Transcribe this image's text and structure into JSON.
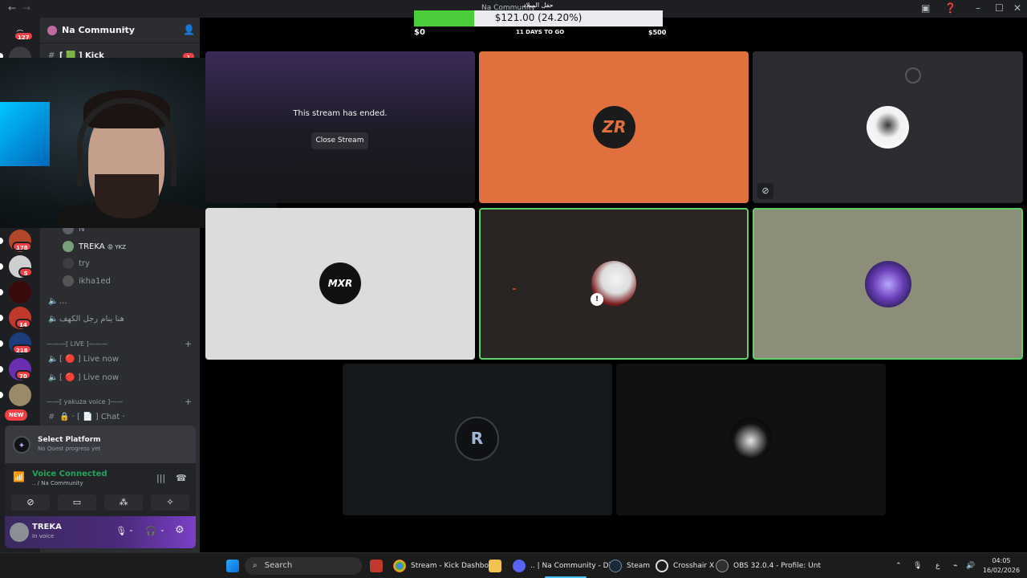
{
  "titlebar": {
    "back_icon": "←",
    "forward_icon": "→",
    "center_text": "Na Community",
    "center_overlay_text": "حفل الميلاد"
  },
  "rail": {
    "servers": [
      {
        "name": "home",
        "badge": "127",
        "color": "#5865f2"
      },
      {
        "name": "server-2",
        "badge": "",
        "color": "#3a3c40"
      },
      {
        "name": "server-mt",
        "badge": "178",
        "color": "#b3472a"
      },
      {
        "name": "server-wolf",
        "badge": "5",
        "color": "#cfcfcf"
      },
      {
        "name": "server-red",
        "badge": "",
        "color": "#5a0c0c"
      },
      {
        "name": "server-anime",
        "badge": "14",
        "color": "#c0392b"
      },
      {
        "name": "server-blue",
        "badge": "218",
        "color": "#1c3c7c"
      },
      {
        "name": "server-purple",
        "badge": "70",
        "color": "#6a2fb0"
      },
      {
        "name": "server-gold",
        "badge": "",
        "color": "#9b8a6a"
      }
    ],
    "new_label": "NEW"
  },
  "sidebar": {
    "guild_name": "Na Community",
    "top_channel": "[ 🟩 ] Kick",
    "top_channel_badge": "1",
    "members": [
      {
        "name": "N",
        "tag": ""
      },
      {
        "name": "TREKA",
        "tag": "😡 YKZ"
      },
      {
        "name": "try",
        "tag": ""
      },
      {
        "name": "ikha1ed",
        "tag": ""
      }
    ],
    "voice_channels_a": [
      "...",
      "هنا ينام رجل الكهف"
    ],
    "category_live": "———[ LIVE ]———",
    "live_channels": [
      "[ 🔴 ] Live now",
      "[ 🔴 ] Live now"
    ],
    "category_yakuza": "——[ yakuza voice ]——",
    "chat_channel": "🔒 · [ 📄 ] Chat ·"
  },
  "quest": {
    "title": "Select Platform",
    "subtitle": "No Quest progress yet"
  },
  "voice_panel": {
    "status": "Voice Connected",
    "location": ".. / Na Community",
    "buttons": [
      "camera-off",
      "screen-share",
      "activities",
      "soundboard"
    ]
  },
  "user_panel": {
    "name": "TREKA",
    "status": "In voice"
  },
  "goal": {
    "amount_text": "$121.00 (24.20%)",
    "progress": 0.242,
    "start_label": "$0",
    "days_label": "11 DAYS TO GO",
    "end_label": "$500"
  },
  "stream_ended": {
    "message": "This stream has ended.",
    "button": "Close Stream"
  },
  "tiles": {
    "zr_logo": "ZR",
    "mxr_logo": "MXR",
    "r_logo": "R"
  },
  "taskbar": {
    "search_placeholder": "Search",
    "apps": [
      {
        "label": "Stream - Kick Dashboar",
        "color": "#e8b400"
      },
      {
        "label": "",
        "color": "#f2c14e"
      },
      {
        "label": ".. | Na Community - Disc",
        "color": "#5865f2"
      },
      {
        "label": "Steam",
        "color": "#1b2838"
      },
      {
        "label": "Crosshair X",
        "color": "#444"
      },
      {
        "label": "OBS 32.0.4 - Profile: Unt",
        "color": "#302e31"
      }
    ],
    "lang": "ع",
    "time": "04:05",
    "date": "16/02/2026"
  }
}
